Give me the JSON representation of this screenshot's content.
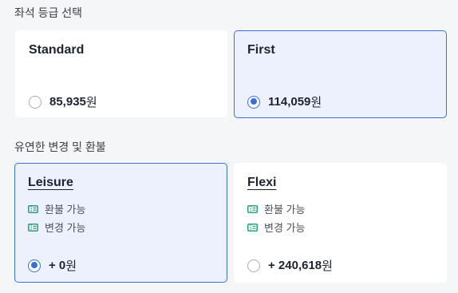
{
  "seat_section": {
    "title": "좌석 등급 선택",
    "options": [
      {
        "name": "Standard",
        "price": "85,935",
        "unit": "원",
        "selected": false
      },
      {
        "name": "First",
        "price": "114,059",
        "unit": "원",
        "selected": true
      }
    ]
  },
  "flex_section": {
    "title": "유연한 변경 및 환불",
    "options": [
      {
        "name": "Leisure",
        "features": [
          "환불 가능",
          "변경 가능"
        ],
        "price": "+ 0",
        "unit": "원",
        "selected": true
      },
      {
        "name": "Flexi",
        "features": [
          "환불 가능",
          "변경 가능"
        ],
        "price": "+ 240,618",
        "unit": "원",
        "selected": false
      }
    ]
  },
  "colors": {
    "accent": "#3b6fd8",
    "selected_bg": "#ecf1fd",
    "ticket_icon": "#2aa07a"
  },
  "icons": {
    "feature": "ticket-icon"
  }
}
